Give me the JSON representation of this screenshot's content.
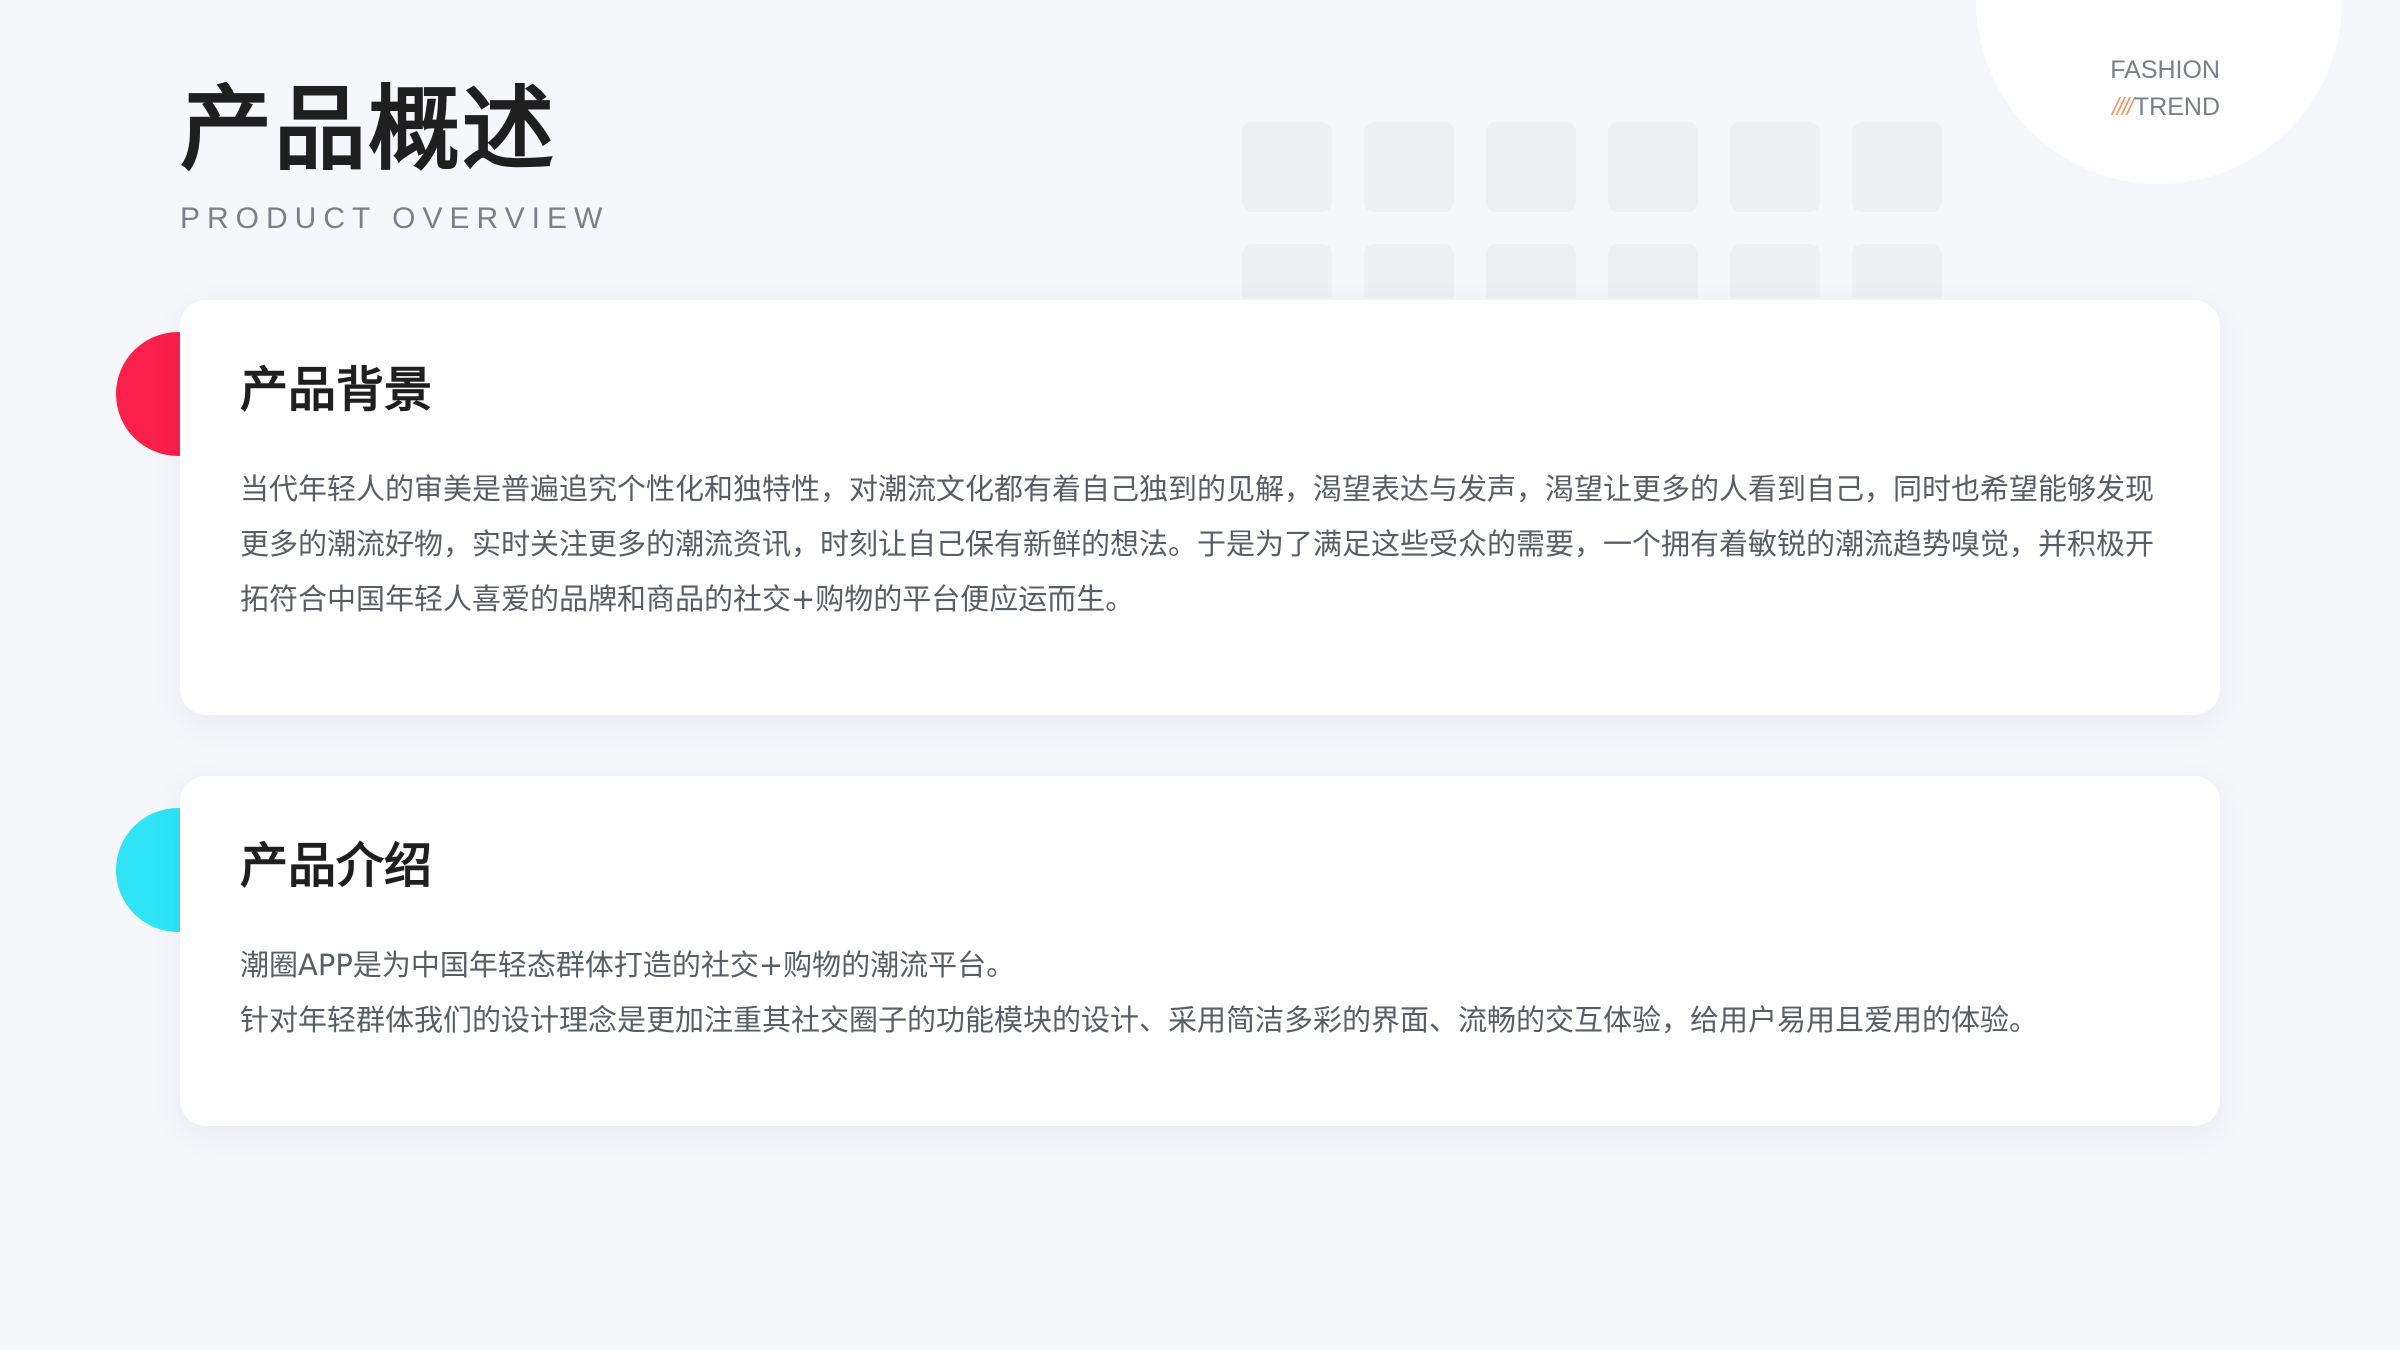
{
  "header": {
    "title": "产品概述",
    "subtitle": "PRODUCT OVERVIEW"
  },
  "badge": {
    "line1": "FASHION",
    "stripes": "////",
    "line2": "TREND"
  },
  "sections": [
    {
      "title": "产品背景",
      "paragraphs": [
        "当代年轻人的审美是普遍追究个性化和独特性，对潮流文化都有着自己独到的见解，渴望表达与发声，渴望让更多的人看到自己，同时也希望能够发现更多的潮流好物，实时关注更多的潮流资讯，时刻让自己保有新鲜的想法。于是为了满足这些受众的需要，一个拥有着敏锐的潮流趋势嗅觉，并积极开拓符合中国年轻人喜爱的品牌和商品的社交+购物的平台便应运而生。"
      ]
    },
    {
      "title": "产品介绍",
      "paragraphs": [
        "潮圈APP是为中国年轻态群体打造的社交+购物的潮流平台。",
        "针对年轻群体我们的设计理念是更加注重其社交圈子的功能模块的设计、采用简洁多彩的界面、流畅的交互体验，给用户易用且爱用的体验。"
      ]
    }
  ],
  "colors": {
    "accent_red": "#fb1f4b",
    "accent_cyan": "#2ee4f6",
    "stripes_orange": "#f29a6a",
    "background": "#f6f7fb"
  }
}
